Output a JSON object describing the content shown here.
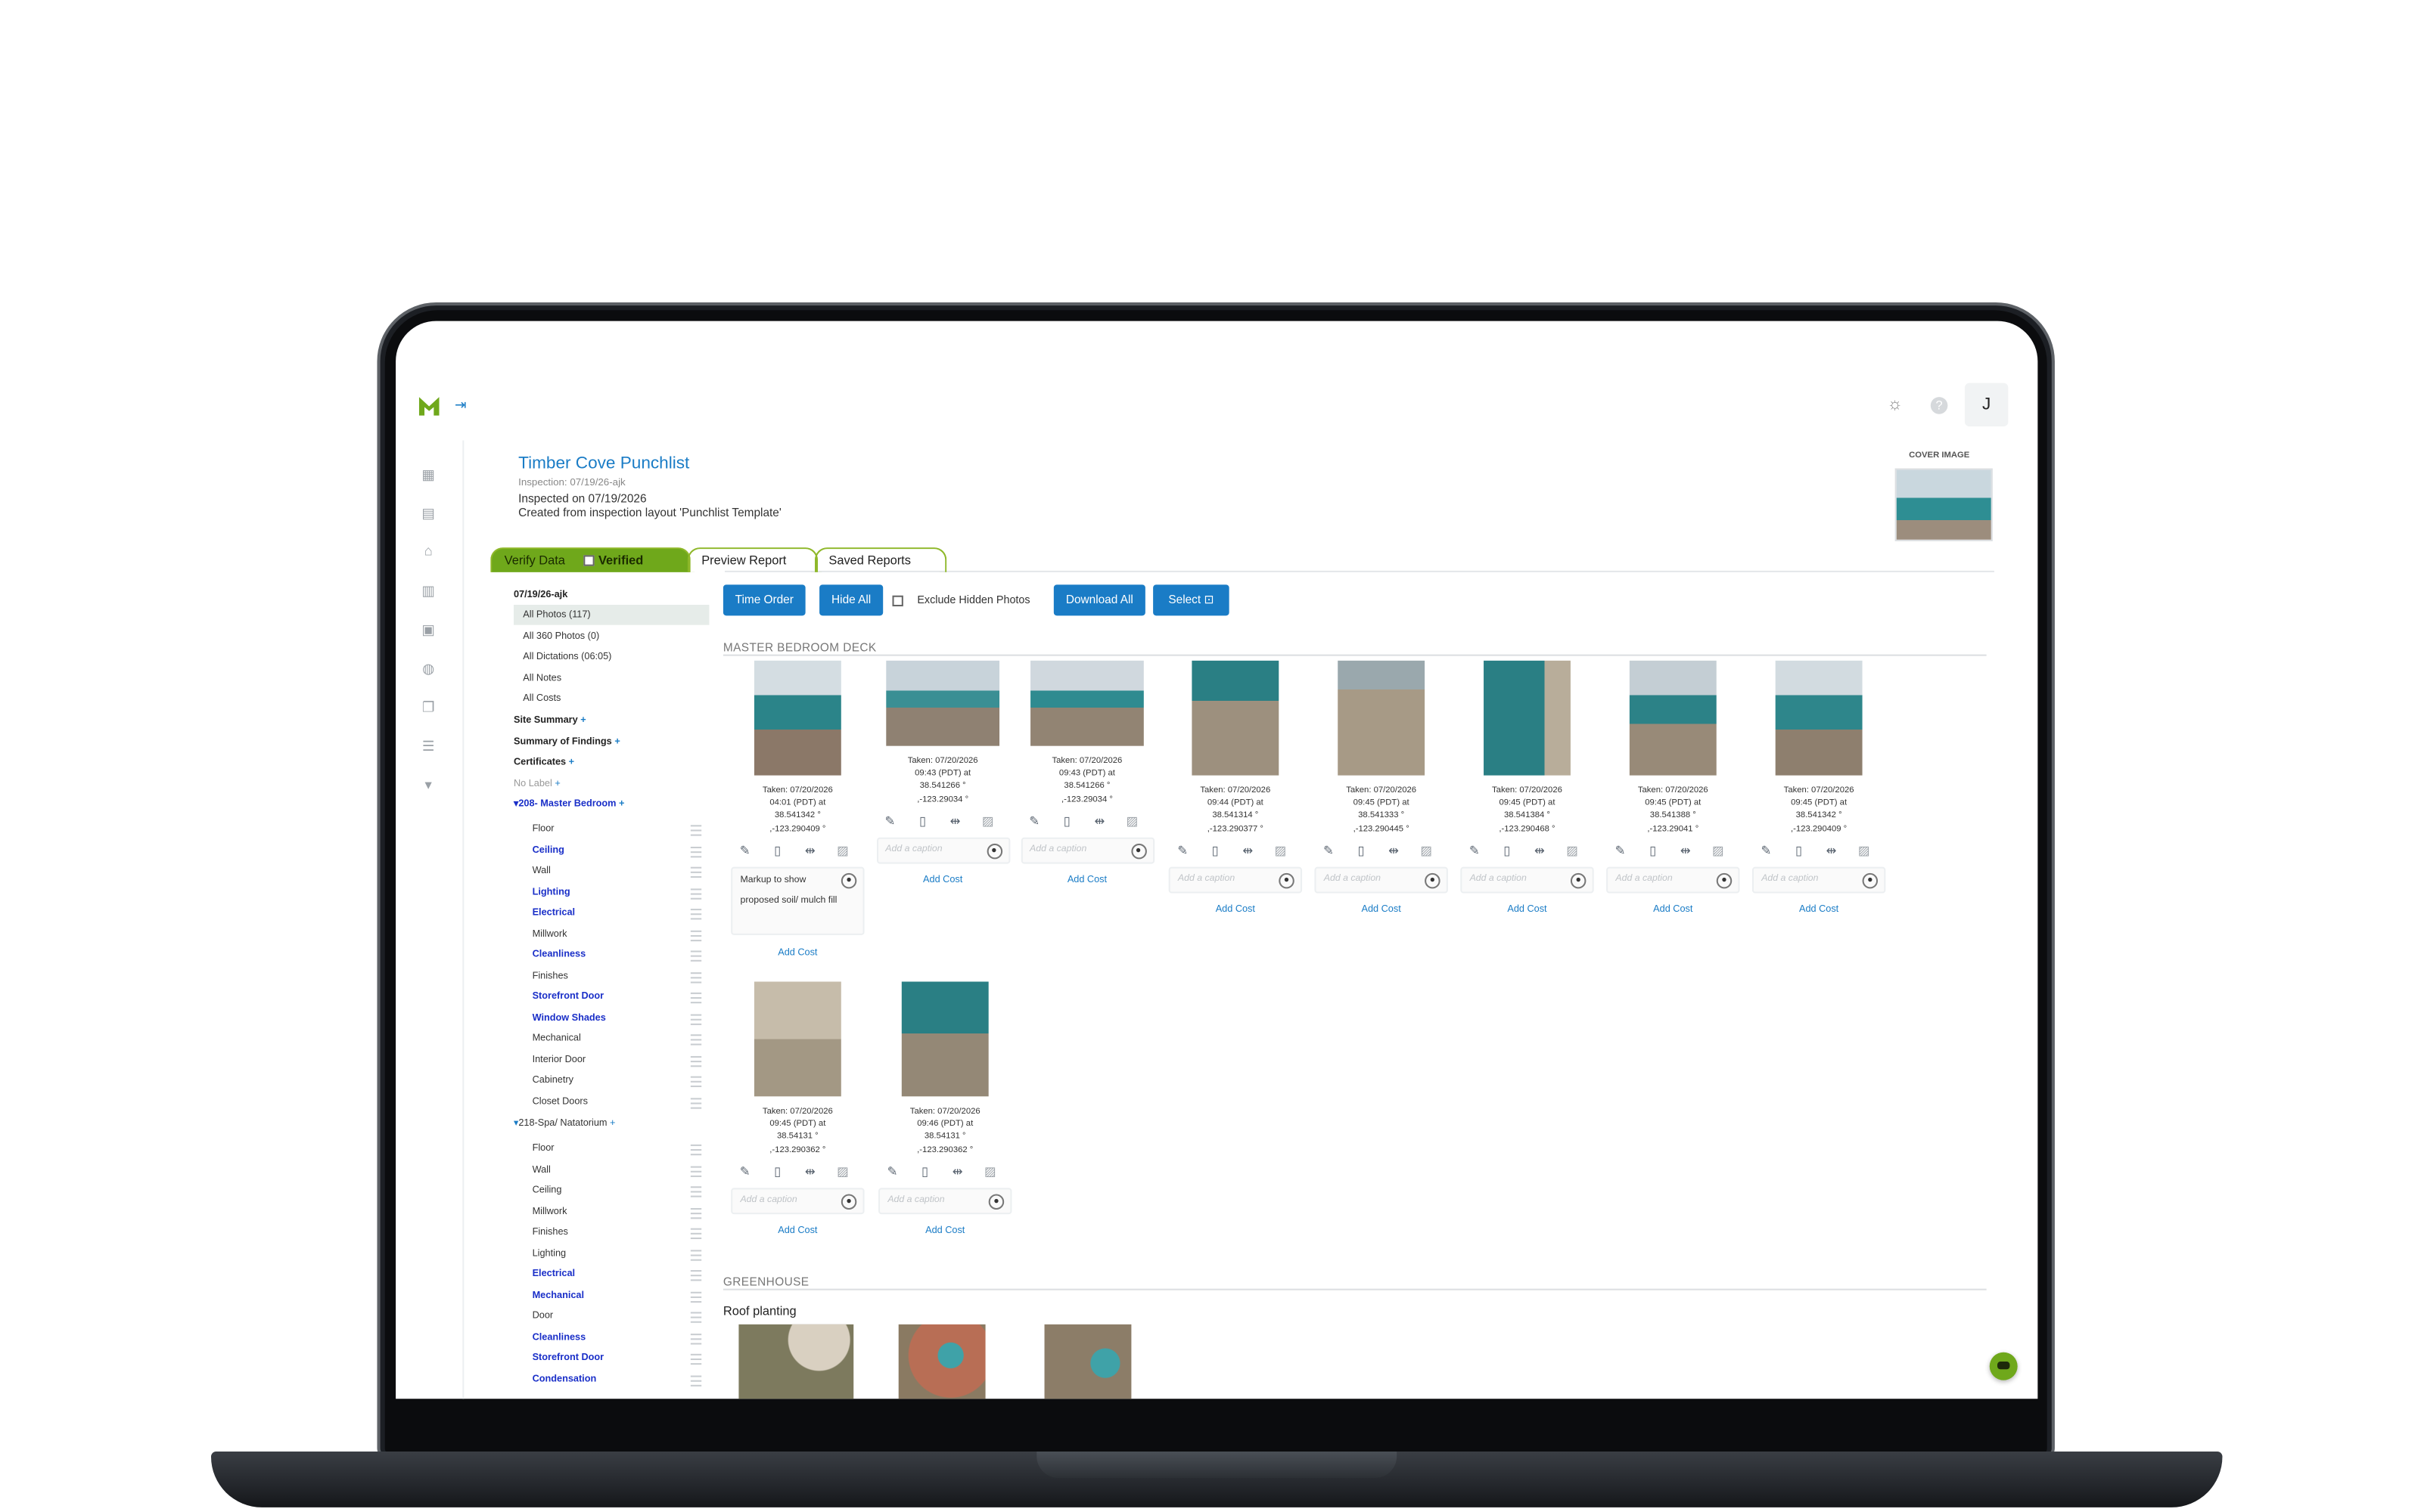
{
  "app": {
    "logo": "m-logo-icon",
    "collapse_icon": "expand-sidebar-icon",
    "avatar_initial": "J",
    "header_icons": [
      "sun-icon",
      "help-icon"
    ]
  },
  "header": {
    "title": "Timber Cove Punchlist",
    "inspection_line": "Inspection: 07/19/26-ajk",
    "inspected_line": "Inspected on 07/19/2026",
    "template_line": "Created from inspection layout 'Punchlist Template'",
    "cover_label": "COVER IMAGE"
  },
  "tabs": {
    "verify": "Verify Data",
    "verified": "Verified",
    "preview": "Preview Report",
    "saved": "Saved Reports"
  },
  "toolbar": {
    "time_order": "Time Order",
    "hide_all": "Hide All",
    "exclude_hidden": "Exclude Hidden Photos",
    "download_all": "Download All",
    "select": "Select"
  },
  "sidebar": {
    "date": "07/19/26-ajk",
    "items": [
      "All Photos (117)",
      "All 360 Photos (0)",
      "All Dictations (06:05)",
      "All Notes",
      "All Costs"
    ],
    "groups": [
      "Site Summary",
      "Summary of Findings",
      "Certificates"
    ],
    "no_label": "No Label",
    "plus": "+",
    "section1": "208- Master Bedroom",
    "section1_items": [
      "Floor",
      "Ceiling",
      "Wall",
      "Lighting",
      "Electrical",
      "Millwork",
      "Cleanliness",
      "Finishes",
      "Storefront Door",
      "Window Shades",
      "Mechanical",
      "Interior Door",
      "Cabinetry",
      "Closet Doors"
    ],
    "section2": "218-Spa/ Natatorium",
    "section2_items": [
      "Floor",
      "Wall",
      "Ceiling",
      "Millwork",
      "Finishes",
      "Lighting",
      "Electrical",
      "Mechanical",
      "Door",
      "Cleanliness",
      "Storefront Door",
      "Condensation"
    ]
  },
  "sections": {
    "master": "MASTER BEDROOM DECK",
    "greenhouse": "GREENHOUSE",
    "roof_planting": "Roof planting"
  },
  "photos": [
    {
      "taken": "Taken: 07/20/2026",
      "time": "04:01 (PDT) at",
      "lat": "38.541342 °",
      "lon": ",-123.290409 °",
      "caption": "Markup to show proposed soil/ mulch fill",
      "cost": "Add Cost"
    },
    {
      "taken": "Taken: 07/20/2026",
      "time": "09:43 (PDT) at",
      "lat": "38.541266 °",
      "lon": ",-123.29034 °",
      "caption": "",
      "cost": "Add Cost"
    },
    {
      "taken": "Taken: 07/20/2026",
      "time": "09:43 (PDT) at",
      "lat": "38.541266 °",
      "lon": ",-123.29034 °",
      "caption": "",
      "cost": "Add Cost"
    },
    {
      "taken": "Taken: 07/20/2026",
      "time": "09:44 (PDT) at",
      "lat": "38.541314 °",
      "lon": ",-123.290377 °",
      "caption": "",
      "cost": "Add Cost"
    },
    {
      "taken": "Taken: 07/20/2026",
      "time": "09:45 (PDT) at",
      "lat": "38.541333 °",
      "lon": ",-123.290445 °",
      "caption": "",
      "cost": "Add Cost"
    },
    {
      "taken": "Taken: 07/20/2026",
      "time": "09:45 (PDT) at",
      "lat": "38.541384 °",
      "lon": ",-123.290468 °",
      "caption": "",
      "cost": "Add Cost"
    },
    {
      "taken": "Taken: 07/20/2026",
      "time": "09:45 (PDT) at",
      "lat": "38.541388 °",
      "lon": ",-123.29041 °",
      "caption": "",
      "cost": "Add Cost"
    },
    {
      "taken": "Taken: 07/20/2026",
      "time": "09:45 (PDT) at",
      "lat": "38.541342 °",
      "lon": ",-123.290409 °",
      "caption": "",
      "cost": "Add Cost"
    },
    {
      "taken": "Taken: 07/20/2026",
      "time": "09:45 (PDT) at",
      "lat": "38.54131 °",
      "lon": ",-123.290362 °",
      "caption": "",
      "cost": "Add Cost"
    },
    {
      "taken": "Taken: 07/20/2026",
      "time": "09:46 (PDT) at",
      "lat": "38.54131 °",
      "lon": ",-123.290362 °",
      "caption": "",
      "cost": "Add Cost"
    }
  ],
  "caption_placeholder": "Add a caption",
  "colors": {
    "accent": "#1a7cc6",
    "brand_green": "#6fa81b",
    "link_blue": "#1a2fc8"
  }
}
